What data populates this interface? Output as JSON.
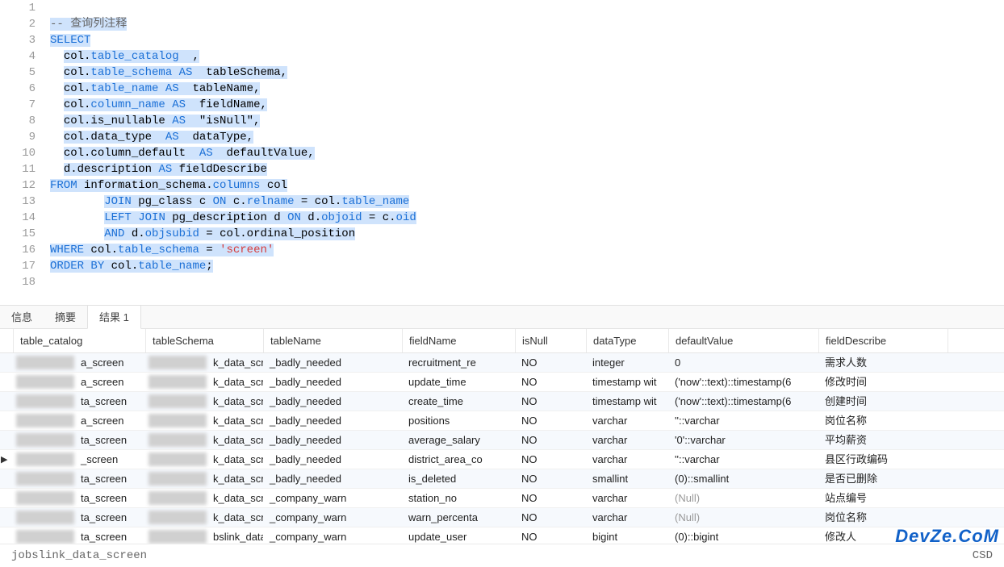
{
  "editor": {
    "lines": [
      "",
      "-- 查询列注释",
      "SELECT",
      "  col.table_catalog  ,",
      "  col.table_schema AS  tableSchema,",
      "  col.table_name AS  tableName,",
      "  col.column_name AS  fieldName,",
      "  col.is_nullable AS  \"isNull\",",
      "  col.data_type  AS  dataType,",
      "  col.column_default  AS  defaultValue,",
      "  d.description AS fieldDescribe",
      "FROM information_schema.columns col",
      "        JOIN pg_class c ON c.relname = col.table_name",
      "        LEFT JOIN pg_description d ON d.objoid = c.oid",
      "        AND d.objsubid = col.ordinal_position",
      "WHERE col.table_schema = 'screen'",
      "ORDER BY col.table_name;",
      ""
    ]
  },
  "tabs": {
    "t0": "信息",
    "t1": "摘要",
    "t2": "结果 1"
  },
  "headers": {
    "cat": "table_catalog",
    "sch": "tableSchema",
    "tbl": "tableName",
    "fld": "fieldName",
    "nul": "isNull",
    "dt": "dataType",
    "def": "defaultValue",
    "des": "fieldDescribe"
  },
  "rows": [
    {
      "cat": "a_screen",
      "sch": "k_data_scre",
      "tbl": "_badly_needed",
      "fld": "recruitment_re",
      "nul": "NO",
      "dt": "integer",
      "def": "0",
      "des": "需求人数"
    },
    {
      "cat": "a_screen",
      "sch": "k_data_scre",
      "tbl": "_badly_needed",
      "fld": "update_time",
      "nul": "NO",
      "dt": "timestamp wit",
      "def": "('now'::text)::timestamp(6",
      "des": "修改时间"
    },
    {
      "cat": "ta_screen",
      "sch": "k_data_scre",
      "tbl": "_badly_needed",
      "fld": "create_time",
      "nul": "NO",
      "dt": "timestamp wit",
      "def": "('now'::text)::timestamp(6",
      "des": "创建时间"
    },
    {
      "cat": "a_screen",
      "sch": "k_data_scre",
      "tbl": "_badly_needed",
      "fld": "positions",
      "nul": "NO",
      "dt": "varchar",
      "def": "''::varchar",
      "des": "岗位名称"
    },
    {
      "cat": "ta_screen",
      "sch": "k_data_scre",
      "tbl": "_badly_needed",
      "fld": "average_salary",
      "nul": "NO",
      "dt": "varchar",
      "def": "'0'::varchar",
      "des": "平均薪资"
    },
    {
      "cat": "_screen",
      "sch": "k_data_scre",
      "tbl": "_badly_needed",
      "fld": "district_area_co",
      "nul": "NO",
      "dt": "varchar",
      "def": "''::varchar",
      "des": "县区行政编码",
      "ptr": true
    },
    {
      "cat": "ta_screen",
      "sch": "k_data_scre",
      "tbl": "_badly_needed",
      "fld": "is_deleted",
      "nul": "NO",
      "dt": "smallint",
      "def": "(0)::smallint",
      "des": "是否已删除"
    },
    {
      "cat": "ta_screen",
      "sch": "k_data_scre",
      "tbl": "_company_warn",
      "fld": "station_no",
      "nul": "NO",
      "dt": "varchar",
      "def": "(Null)",
      "des": "站点编号",
      "null": true
    },
    {
      "cat": "ta_screen",
      "sch": "k_data_scre",
      "tbl": "_company_warn",
      "fld": "warn_percenta",
      "nul": "NO",
      "dt": "varchar",
      "def": "(Null)",
      "des": "岗位名称",
      "null": true
    },
    {
      "cat": "ta_screen",
      "sch": "bslink_data_scre",
      "tbl": "_company_warn",
      "fld": "update_user",
      "nul": "NO",
      "dt": "bigint",
      "def": "(0)::bigint",
      "des": "修改人"
    }
  ],
  "status": {
    "left": "jobslink_data_screen",
    "right": "CSD"
  },
  "watermark": "DevZe.CoM"
}
